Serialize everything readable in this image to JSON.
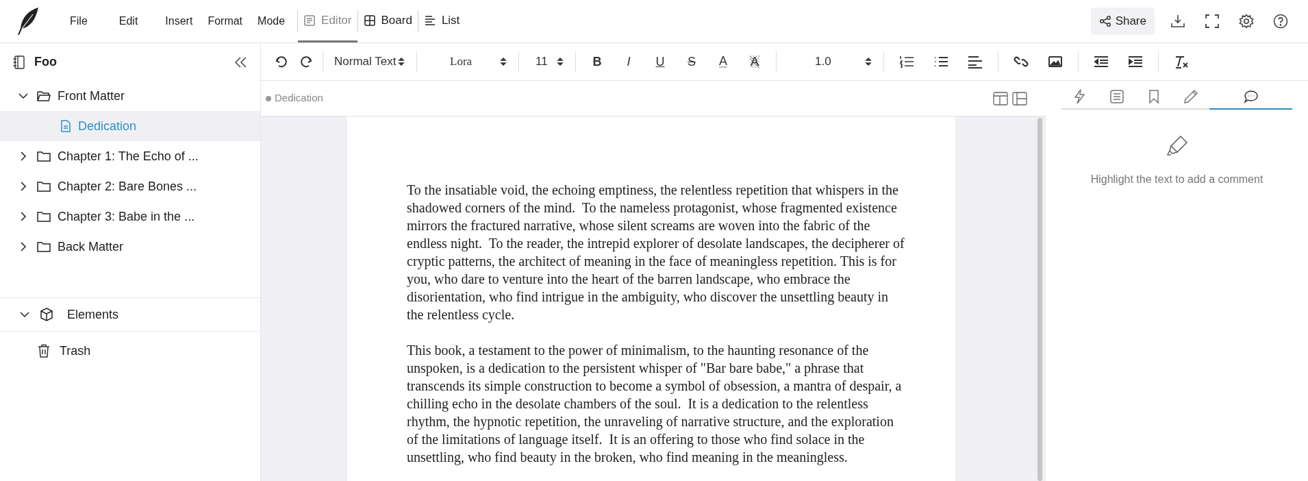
{
  "menu": [
    "File",
    "Edit",
    "Insert",
    "Format",
    "Mode"
  ],
  "view_tabs": [
    {
      "label": "Editor",
      "kind": "editor",
      "selected": true
    },
    {
      "label": "Board",
      "kind": "board",
      "selected": false
    },
    {
      "label": "List",
      "kind": "list",
      "selected": false
    }
  ],
  "share_button": "Share",
  "sidebar": {
    "title": "Foo",
    "tree": [
      {
        "label": "Front Matter",
        "kind": "folder",
        "expanded": true,
        "selected": false,
        "children": [
          {
            "label": "Dedication",
            "kind": "file",
            "selected": true
          }
        ]
      },
      {
        "label": "Chapter 1: The Echo of ...",
        "kind": "folder",
        "expanded": false,
        "selected": false
      },
      {
        "label": "Chapter 2: Bare Bones ...",
        "kind": "folder",
        "expanded": false,
        "selected": false
      },
      {
        "label": "Chapter 3: Babe in the ...",
        "kind": "folder",
        "expanded": false,
        "selected": false
      },
      {
        "label": "Back Matter",
        "kind": "folder",
        "expanded": false,
        "selected": false
      }
    ],
    "elements": {
      "label": "Elements",
      "expanded": true
    },
    "trash": "Trash"
  },
  "toolbar": {
    "style": "Normal Text",
    "font": "Lora",
    "size": "11",
    "line_spacing": "1.0",
    "format": [
      {
        "kind": "bold",
        "glyph": "B"
      },
      {
        "kind": "italic",
        "glyph": "I"
      },
      {
        "kind": "underline",
        "glyph": "U"
      },
      {
        "kind": "strike",
        "glyph": "S"
      },
      {
        "kind": "color",
        "glyph": "A"
      },
      {
        "kind": "highlight",
        "glyph": "A"
      }
    ]
  },
  "editor": {
    "breadcrumb": "Dedication",
    "paragraphs": [
      "To the insatiable void, the echoing emptiness, the relentless repetition that whispers in the shadowed corners of the mind.  To the nameless protagonist, whose fragmented existence mirrors the fractured narrative, whose silent screams are woven into the fabric of the endless night.  To the reader, the intrepid explorer of desolate landscapes, the decipherer of cryptic patterns, the architect of meaning in the face of meaningless repetition. This is for you, who dare to venture into the heart of the barren landscape, who embrace the disorientation, who find intrigue in the ambiguity, who discover the unsettling beauty in the relentless cycle.",
      "This book, a testament to the power of minimalism, to the haunting resonance of the unspoken, is a dedication to the persistent whisper of \"Bar bare babe,\" a phrase that transcends its simple construction to become a symbol of obsession, a mantra of despair, a chilling echo in the desolate chambers of the soul.  It is a dedication to the relentless rhythm, the hypnotic repetition, the unraveling of narrative structure, and the exploration of the limitations of language itself.  It is an offering to those who find solace in the unsettling, who find beauty in the broken, who find meaning in the meaningless."
    ]
  },
  "right_panel": {
    "tabs": [
      {
        "kind": "actions",
        "selected": false
      },
      {
        "kind": "notes",
        "selected": false
      },
      {
        "kind": "bookmarks",
        "selected": false
      },
      {
        "kind": "edits",
        "selected": false
      },
      {
        "kind": "comments",
        "selected": true
      }
    ],
    "empty_message": "Highlight the text to add a comment"
  }
}
